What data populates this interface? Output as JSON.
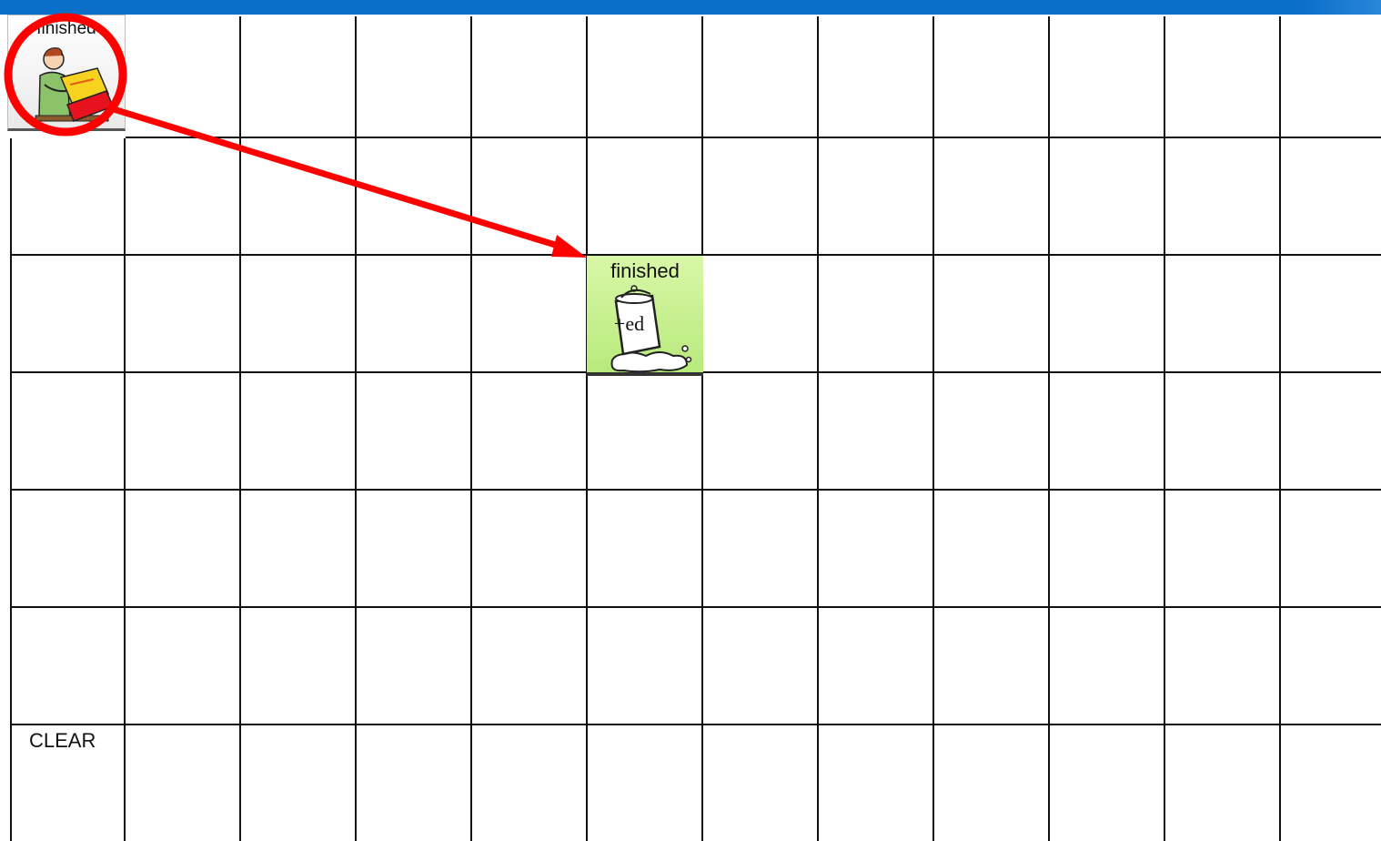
{
  "header": {
    "color": "#0a6fc9"
  },
  "grid": {
    "rows": 7,
    "cols": 12
  },
  "buttons": {
    "finished_source": {
      "label": "finished",
      "icon": "person-closing-book-icon",
      "background": "#f2f2f2"
    },
    "finished_target": {
      "label": "finished",
      "icon": "spilled-bucket-ed-icon",
      "badge": "+ed",
      "background": "#c4ef8c"
    },
    "clear": {
      "label": "CLEAR"
    }
  },
  "annotation": {
    "color": "#ff0000",
    "shapes": [
      "circle-highlight",
      "arrow"
    ]
  }
}
